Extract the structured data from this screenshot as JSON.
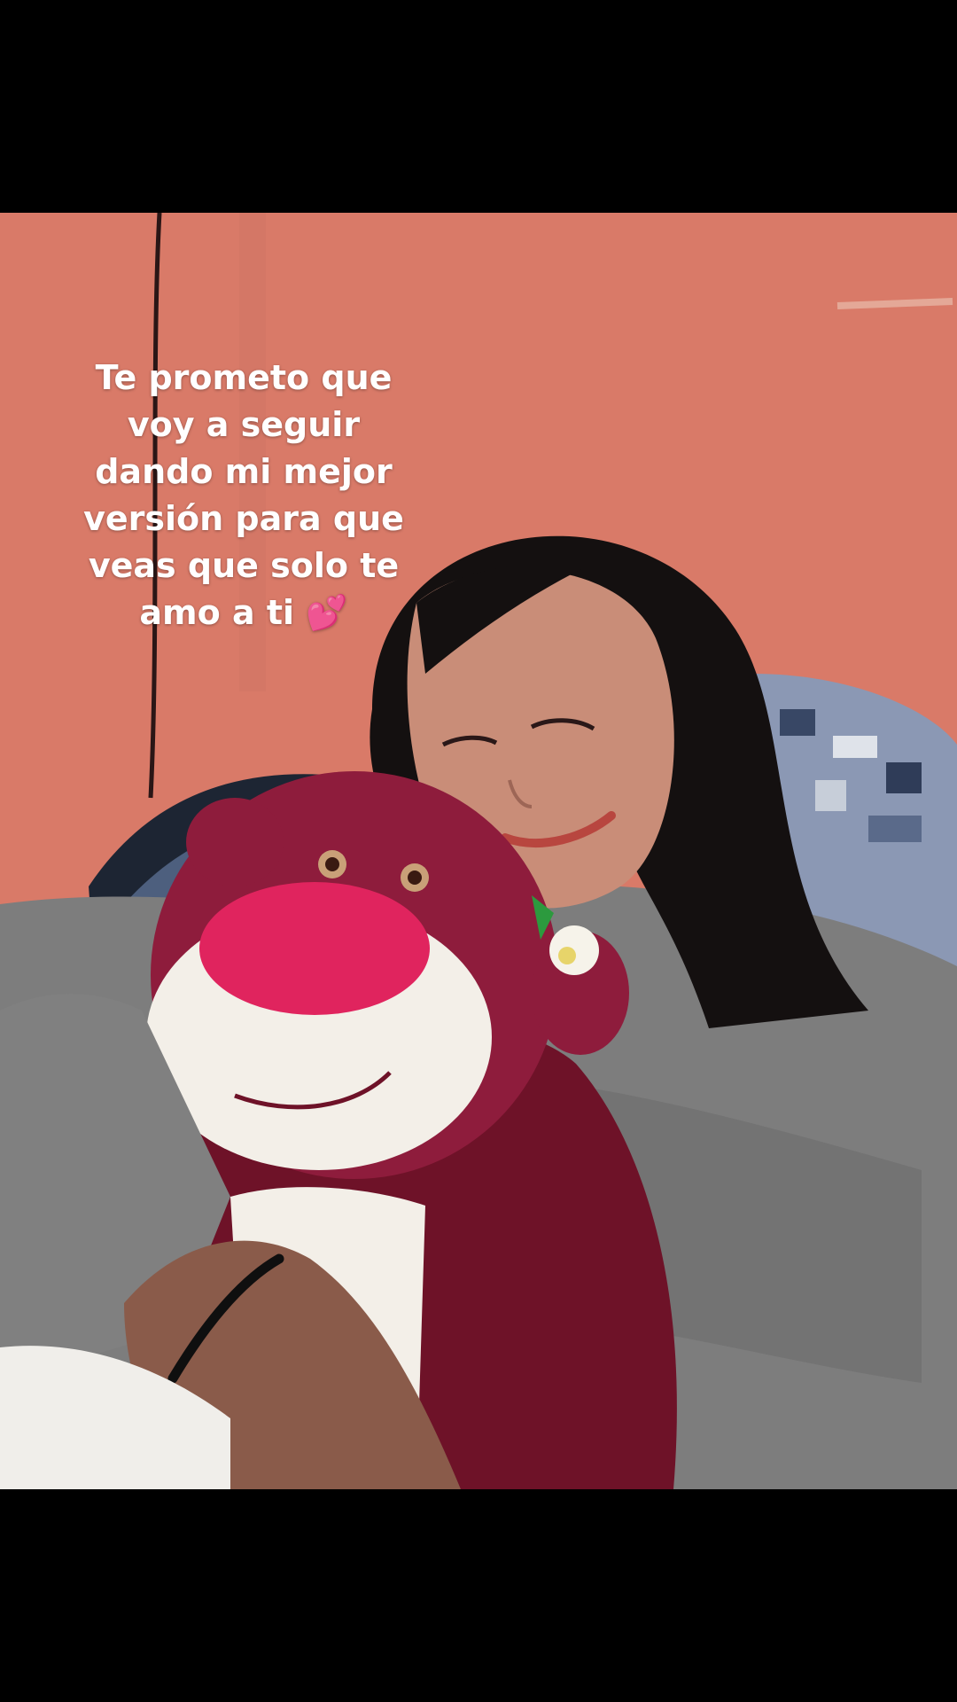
{
  "caption": {
    "text": "Te prometo que\nvoy a seguir\ndando mi mejor\nversión para que\nveas que solo te\namo a ti 💕"
  },
  "scene": {
    "wall_color": "#d97a68",
    "sweater_color": "#7d7d7d",
    "bear_color": "#8e1c3c",
    "bear_nose_color": "#e0245e",
    "bear_muzzle_color": "#f3efe8",
    "hair_color": "#141010",
    "skin_color": "#c98d78",
    "sofa_color": "#4d5f7e"
  }
}
